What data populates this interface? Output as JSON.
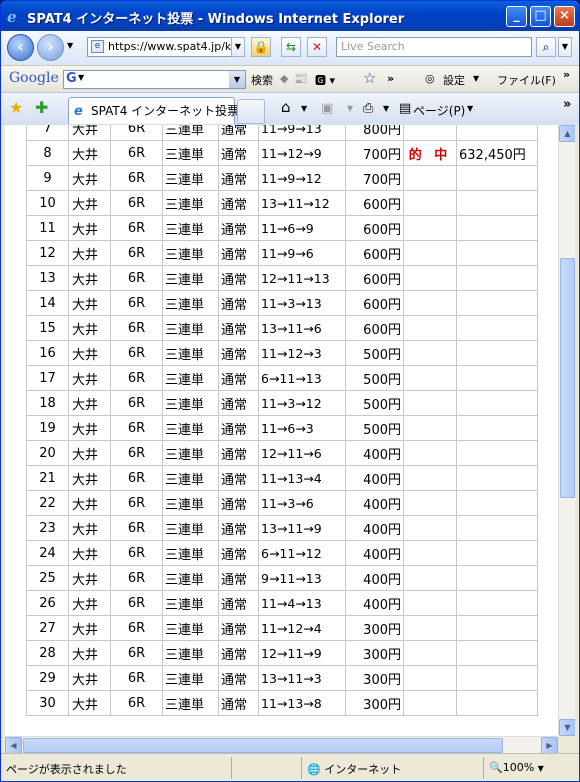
{
  "window": {
    "title": "SPAT4 インターネット投票 - Windows Internet Explorer",
    "minimize": "_",
    "maximize": "□",
    "close": "×"
  },
  "address_bar": {
    "url": "https://www.spat4.jp/k",
    "search_placeholder": "Live Search"
  },
  "google_bar": {
    "logo": "Google",
    "g_label": "G",
    "search_label": "検索",
    "settings_label": "設定",
    "file_label": "ファイル(F)"
  },
  "tab_bar": {
    "tab_title": "SPAT4 インターネット投票",
    "page_menu": "ページ(P)"
  },
  "table": {
    "rows": [
      {
        "no": "7",
        "venue": "大井",
        "race": "6R",
        "bet_type": "三連単",
        "method": "通常",
        "combo": "11→9→13",
        "amount": "800円",
        "hit": "",
        "payout": ""
      },
      {
        "no": "8",
        "venue": "大井",
        "race": "6R",
        "bet_type": "三連単",
        "method": "通常",
        "combo": "11→12→9",
        "amount": "700円",
        "hit": "的 中",
        "payout": "632,450円"
      },
      {
        "no": "9",
        "venue": "大井",
        "race": "6R",
        "bet_type": "三連単",
        "method": "通常",
        "combo": "11→9→12",
        "amount": "700円",
        "hit": "",
        "payout": ""
      },
      {
        "no": "10",
        "venue": "大井",
        "race": "6R",
        "bet_type": "三連単",
        "method": "通常",
        "combo": "13→11→12",
        "amount": "600円",
        "hit": "",
        "payout": ""
      },
      {
        "no": "11",
        "venue": "大井",
        "race": "6R",
        "bet_type": "三連単",
        "method": "通常",
        "combo": "11→6→9",
        "amount": "600円",
        "hit": "",
        "payout": ""
      },
      {
        "no": "12",
        "venue": "大井",
        "race": "6R",
        "bet_type": "三連単",
        "method": "通常",
        "combo": "11→9→6",
        "amount": "600円",
        "hit": "",
        "payout": ""
      },
      {
        "no": "13",
        "venue": "大井",
        "race": "6R",
        "bet_type": "三連単",
        "method": "通常",
        "combo": "12→11→13",
        "amount": "600円",
        "hit": "",
        "payout": ""
      },
      {
        "no": "14",
        "venue": "大井",
        "race": "6R",
        "bet_type": "三連単",
        "method": "通常",
        "combo": "11→3→13",
        "amount": "600円",
        "hit": "",
        "payout": ""
      },
      {
        "no": "15",
        "venue": "大井",
        "race": "6R",
        "bet_type": "三連単",
        "method": "通常",
        "combo": "13→11→6",
        "amount": "600円",
        "hit": "",
        "payout": ""
      },
      {
        "no": "16",
        "venue": "大井",
        "race": "6R",
        "bet_type": "三連単",
        "method": "通常",
        "combo": "11→12→3",
        "amount": "500円",
        "hit": "",
        "payout": ""
      },
      {
        "no": "17",
        "venue": "大井",
        "race": "6R",
        "bet_type": "三連単",
        "method": "通常",
        "combo": "6→11→13",
        "amount": "500円",
        "hit": "",
        "payout": ""
      },
      {
        "no": "18",
        "venue": "大井",
        "race": "6R",
        "bet_type": "三連単",
        "method": "通常",
        "combo": "11→3→12",
        "amount": "500円",
        "hit": "",
        "payout": ""
      },
      {
        "no": "19",
        "venue": "大井",
        "race": "6R",
        "bet_type": "三連単",
        "method": "通常",
        "combo": "11→6→3",
        "amount": "500円",
        "hit": "",
        "payout": ""
      },
      {
        "no": "20",
        "venue": "大井",
        "race": "6R",
        "bet_type": "三連単",
        "method": "通常",
        "combo": "12→11→6",
        "amount": "400円",
        "hit": "",
        "payout": ""
      },
      {
        "no": "21",
        "venue": "大井",
        "race": "6R",
        "bet_type": "三連単",
        "method": "通常",
        "combo": "11→13→4",
        "amount": "400円",
        "hit": "",
        "payout": ""
      },
      {
        "no": "22",
        "venue": "大井",
        "race": "6R",
        "bet_type": "三連単",
        "method": "通常",
        "combo": "11→3→6",
        "amount": "400円",
        "hit": "",
        "payout": ""
      },
      {
        "no": "23",
        "venue": "大井",
        "race": "6R",
        "bet_type": "三連単",
        "method": "通常",
        "combo": "13→11→9",
        "amount": "400円",
        "hit": "",
        "payout": ""
      },
      {
        "no": "24",
        "venue": "大井",
        "race": "6R",
        "bet_type": "三連単",
        "method": "通常",
        "combo": "6→11→12",
        "amount": "400円",
        "hit": "",
        "payout": ""
      },
      {
        "no": "25",
        "venue": "大井",
        "race": "6R",
        "bet_type": "三連単",
        "method": "通常",
        "combo": "9→11→13",
        "amount": "400円",
        "hit": "",
        "payout": ""
      },
      {
        "no": "26",
        "venue": "大井",
        "race": "6R",
        "bet_type": "三連単",
        "method": "通常",
        "combo": "11→4→13",
        "amount": "400円",
        "hit": "",
        "payout": ""
      },
      {
        "no": "27",
        "venue": "大井",
        "race": "6R",
        "bet_type": "三連単",
        "method": "通常",
        "combo": "11→12→4",
        "amount": "300円",
        "hit": "",
        "payout": ""
      },
      {
        "no": "28",
        "venue": "大井",
        "race": "6R",
        "bet_type": "三連単",
        "method": "通常",
        "combo": "12→11→9",
        "amount": "300円",
        "hit": "",
        "payout": ""
      },
      {
        "no": "29",
        "venue": "大井",
        "race": "6R",
        "bet_type": "三連単",
        "method": "通常",
        "combo": "13→11→3",
        "amount": "300円",
        "hit": "",
        "payout": ""
      },
      {
        "no": "30",
        "venue": "大井",
        "race": "6R",
        "bet_type": "三連単",
        "method": "通常",
        "combo": "11→13→8",
        "amount": "300円",
        "hit": "",
        "payout": ""
      }
    ]
  },
  "status_bar": {
    "status_text": "ページが表示されました",
    "zone": "インターネット",
    "zoom": "100%"
  }
}
